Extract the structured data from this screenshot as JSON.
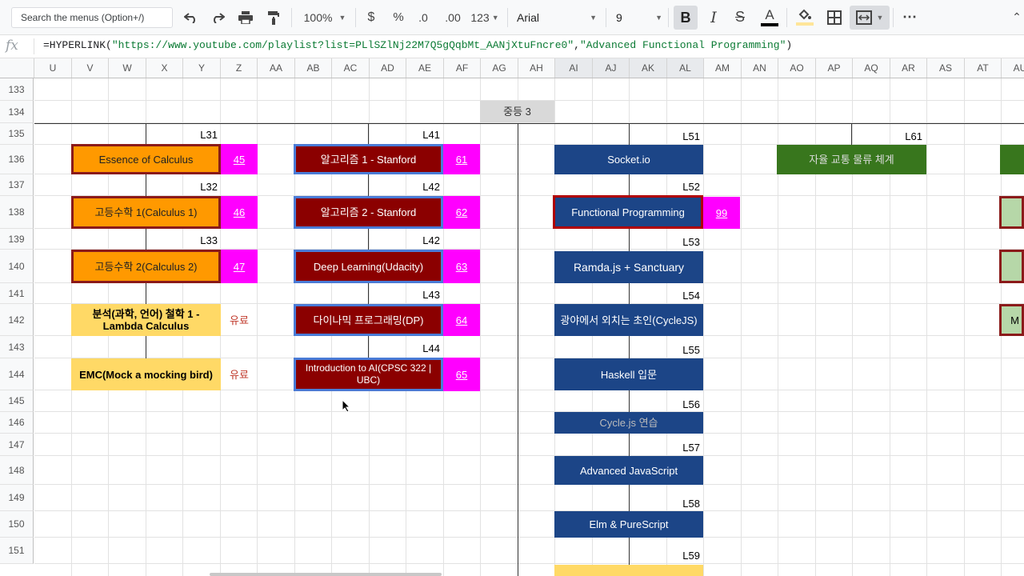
{
  "toolbar": {
    "search_placeholder": "Search the menus (Option+/)",
    "zoom": "100%",
    "currency": "$",
    "percent": "%",
    "dec_less": ".0",
    "dec_more": ".00",
    "format": "123",
    "font": "Arial",
    "font_size": "9"
  },
  "formula": {
    "fx": "fx",
    "prefix": "=HYPERLINK(",
    "url": "\"https://www.youtube.com/playlist?list=PLlSZlNj22M7Q5gQqbMt_AANjXtuFncre0\"",
    "comma": ",",
    "text": "\"Advanced Functional Programming\"",
    "suffix": ")"
  },
  "columns": [
    "U",
    "V",
    "W",
    "X",
    "Y",
    "Z",
    "AA",
    "AB",
    "AC",
    "AD",
    "AE",
    "AF",
    "AG",
    "AH",
    "AI",
    "AJ",
    "AK",
    "AL",
    "AM",
    "AN",
    "AO",
    "AP",
    "AQ",
    "AR",
    "AS",
    "AT",
    "AU"
  ],
  "rows": [
    "133",
    "134",
    "135",
    "136",
    "137",
    "138",
    "139",
    "140",
    "141",
    "142",
    "143",
    "144",
    "145",
    "146",
    "147",
    "148",
    "149",
    "150",
    "151"
  ],
  "section_header": "중등 3",
  "labels": {
    "l31": "L31",
    "l32": "L32",
    "l33": "L33",
    "l41": "L41",
    "l42a": "L42",
    "l42b": "L42",
    "l43": "L43",
    "l44": "L44",
    "l51": "L51",
    "l52": "L52",
    "l53": "L53",
    "l54": "L54",
    "l55": "L55",
    "l56": "L56",
    "l57": "L57",
    "l58": "L58",
    "l59": "L59",
    "l61": "L61"
  },
  "col1": {
    "items": [
      "Essence of Calculus",
      "고등수학 1(Calculus 1)",
      "고등수학 2(Calculus 2)",
      "분석(과학, 언어) 철학 1 - Lambda Calculus",
      "EMC(Mock a mocking bird)"
    ],
    "links": [
      "45",
      "46",
      "47",
      "유료",
      "유료"
    ]
  },
  "col2": {
    "items": [
      "알고리즘 1 - Stanford",
      "알고리즘 2 - Stanford",
      "Deep Learning(Udacity)",
      "다이나믹 프로그래밍(DP)",
      "Introduction to AI(CPSC 322 | UBC)"
    ],
    "links": [
      "61",
      "62",
      "63",
      "64",
      "65"
    ]
  },
  "col3": {
    "items": [
      "Socket.io",
      "Functional Programming",
      "Ramda.js + Sanctuary",
      "광야에서 외치는 초인(CycleJS)",
      "Haskell 입문",
      "Cycle.js 연습",
      "Advanced JavaScript",
      "Elm & PureScript"
    ],
    "link_fp": "99"
  },
  "col4": {
    "item": "자율 교통 물류 체계",
    "partial": "M"
  }
}
